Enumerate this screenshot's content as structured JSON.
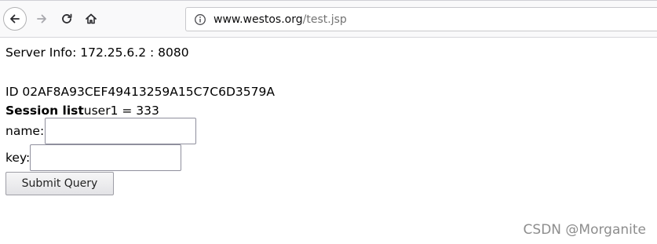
{
  "browser": {
    "url_host": "www.westos.org",
    "url_path": "/test.jsp",
    "icons": {
      "back": "back-arrow-icon",
      "forward": "forward-arrow-icon",
      "reload": "reload-icon",
      "home": "home-icon",
      "site_info": "info-icon"
    }
  },
  "page": {
    "server_info": "Server Info: 172.25.6.2 : 8080",
    "session_id": "ID 02AF8A93CEF49413259A15C7C6D3579A",
    "session_list_label": "Session list",
    "session_list_value": "user1 = 333",
    "name_label": "name:",
    "name_value": "",
    "key_label": "key:",
    "key_value": "",
    "submit_label": "Submit Query"
  },
  "watermark": "CSDN @Morganite"
}
